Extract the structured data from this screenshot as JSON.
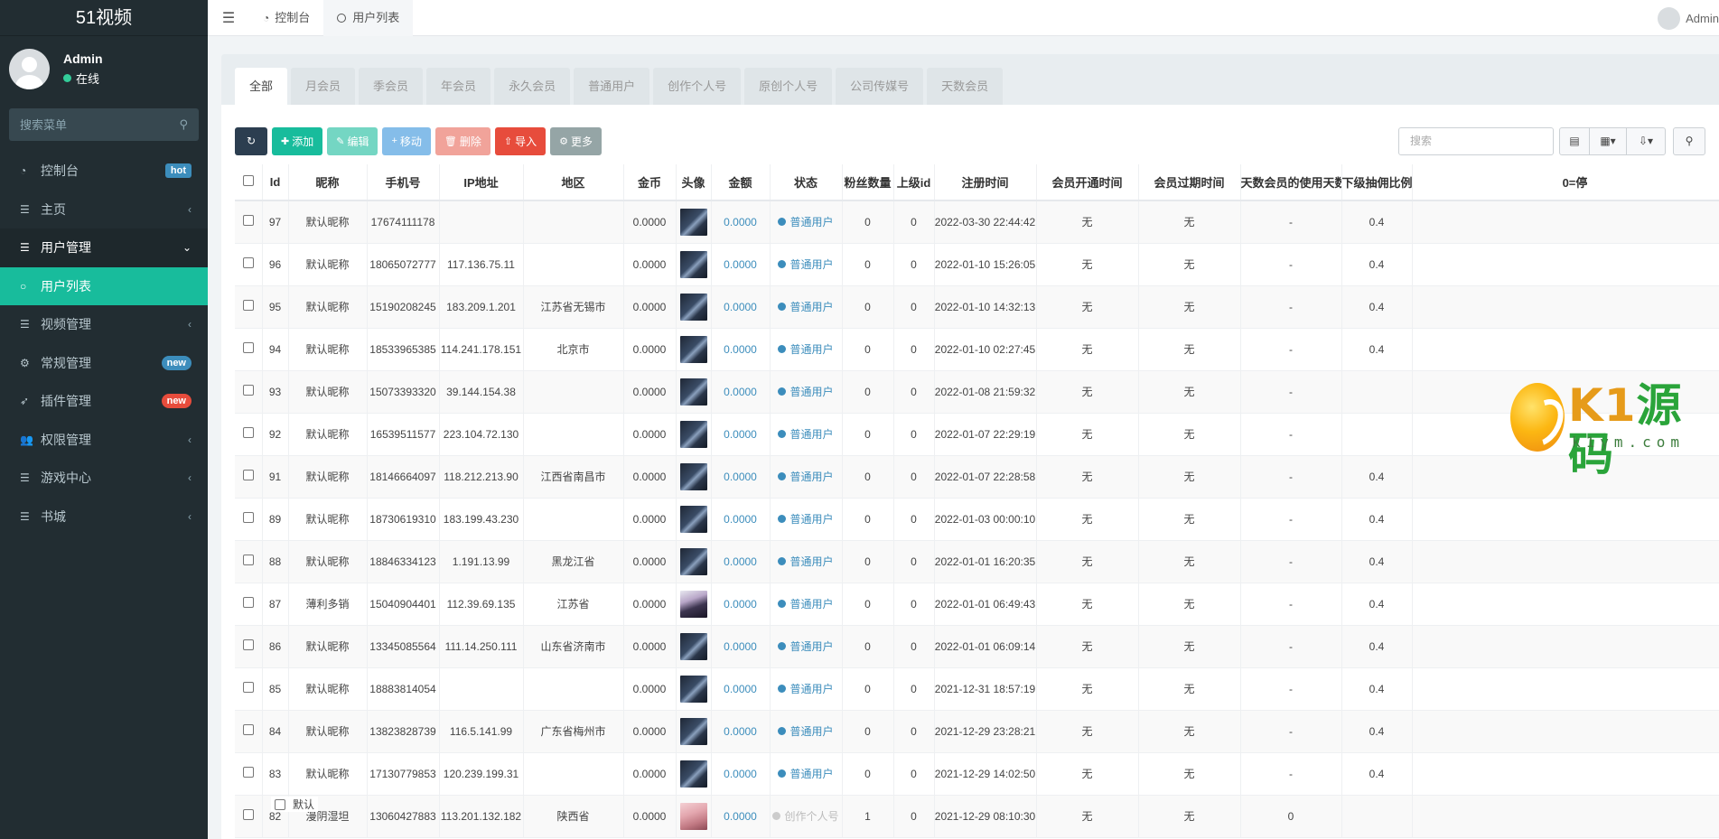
{
  "app": {
    "title": "51视频"
  },
  "sidebar": {
    "user": {
      "name": "Admin",
      "status": "在线"
    },
    "search_placeholder": "搜索菜单",
    "items": [
      {
        "icon": "dashboard-icon",
        "glyph": "◔",
        "label": "控制台",
        "badge": "hot",
        "badge_color": "#3c8dbc",
        "state": "normal",
        "arrow": ""
      },
      {
        "icon": "list-icon",
        "glyph": "☰",
        "label": "主页",
        "badge": "",
        "state": "normal",
        "arrow": "‹"
      },
      {
        "icon": "list-icon",
        "glyph": "☰",
        "label": "用户管理",
        "badge": "",
        "state": "open",
        "arrow": "⌄"
      },
      {
        "icon": "circle-icon",
        "glyph": "○",
        "label": "用户列表",
        "badge": "",
        "state": "active",
        "arrow": ""
      },
      {
        "icon": "list-icon",
        "glyph": "☰",
        "label": "视频管理",
        "badge": "",
        "state": "normal",
        "arrow": "‹"
      },
      {
        "icon": "cogs-icon",
        "glyph": "⚙",
        "label": "常规管理",
        "badge": "new",
        "badge_color": "#3c8dbc",
        "state": "normal",
        "arrow": ""
      },
      {
        "icon": "rocket-icon",
        "glyph": "➶",
        "label": "插件管理",
        "badge": "new",
        "badge_color": "#e74c3c",
        "state": "normal",
        "arrow": ""
      },
      {
        "icon": "users-icon",
        "glyph": "👥",
        "label": "权限管理",
        "badge": "",
        "state": "normal",
        "arrow": "‹"
      },
      {
        "icon": "list-icon",
        "glyph": "☰",
        "label": "游戏中心",
        "badge": "",
        "state": "normal",
        "arrow": "‹"
      },
      {
        "icon": "list-icon",
        "glyph": "☰",
        "label": "书城",
        "badge": "",
        "state": "normal",
        "arrow": "‹"
      }
    ]
  },
  "topbar": {
    "tabs": [
      {
        "label": "控制台",
        "icon": "dashboard-icon"
      },
      {
        "label": "用户列表",
        "icon": "circle-icon"
      }
    ],
    "user": "Admin"
  },
  "filter_tabs": [
    "全部",
    "月会员",
    "季会员",
    "年会员",
    "永久会员",
    "普通用户",
    "创作个人号",
    "原创个人号",
    "公司传媒号",
    "天数会员"
  ],
  "toolbar": {
    "add": "添加",
    "edit": "编辑",
    "move": "移动",
    "delete": "删除",
    "import": "导入",
    "more": "更多",
    "search_placeholder": "搜索"
  },
  "table": {
    "columns": [
      "",
      "Id",
      "昵称",
      "手机号",
      "IP地址",
      "地区",
      "金币",
      "头像",
      "金额",
      "状态",
      "粉丝数量",
      "上级id",
      "注册时间",
      "会员开通时间",
      "会员过期时间",
      "天数会员的使用天数",
      "下级抽佣比例",
      "0=停"
    ],
    "rows": [
      {
        "id": "97",
        "nick": "默认昵称",
        "phone": "17674111178",
        "ip": "",
        "region": "",
        "coin": "0.0000",
        "avatar": "dark",
        "amount": "0.0000",
        "status": "普通用户",
        "fans": "0",
        "parent": "0",
        "reg": "2022-03-30 22:44:42",
        "vip_start": "无",
        "vip_end": "无",
        "days": "-",
        "ratio": "0.4"
      },
      {
        "id": "96",
        "nick": "默认昵称",
        "phone": "18065072777",
        "ip": "117.136.75.11",
        "region": "",
        "coin": "0.0000",
        "avatar": "dark",
        "amount": "0.0000",
        "status": "普通用户",
        "fans": "0",
        "parent": "0",
        "reg": "2022-01-10 15:26:05",
        "vip_start": "无",
        "vip_end": "无",
        "days": "-",
        "ratio": "0.4"
      },
      {
        "id": "95",
        "nick": "默认昵称",
        "phone": "15190208245",
        "ip": "183.209.1.201",
        "region": "江苏省无锡市",
        "coin": "0.0000",
        "avatar": "dark",
        "amount": "0.0000",
        "status": "普通用户",
        "fans": "0",
        "parent": "0",
        "reg": "2022-01-10 14:32:13",
        "vip_start": "无",
        "vip_end": "无",
        "days": "-",
        "ratio": "0.4"
      },
      {
        "id": "94",
        "nick": "默认昵称",
        "phone": "18533965385",
        "ip": "114.241.178.151",
        "region": "北京市",
        "coin": "0.0000",
        "avatar": "dark",
        "amount": "0.0000",
        "status": "普通用户",
        "fans": "0",
        "parent": "0",
        "reg": "2022-01-10 02:27:45",
        "vip_start": "无",
        "vip_end": "无",
        "days": "-",
        "ratio": "0.4"
      },
      {
        "id": "93",
        "nick": "默认昵称",
        "phone": "15073393320",
        "ip": "39.144.154.38",
        "region": "",
        "coin": "0.0000",
        "avatar": "dark",
        "amount": "0.0000",
        "status": "普通用户",
        "fans": "0",
        "parent": "0",
        "reg": "2022-01-08 21:59:32",
        "vip_start": "无",
        "vip_end": "无",
        "days": "-",
        "ratio": ""
      },
      {
        "id": "92",
        "nick": "默认昵称",
        "phone": "16539511577",
        "ip": "223.104.72.130",
        "region": "",
        "coin": "0.0000",
        "avatar": "dark",
        "amount": "0.0000",
        "status": "普通用户",
        "fans": "0",
        "parent": "0",
        "reg": "2022-01-07 22:29:19",
        "vip_start": "无",
        "vip_end": "无",
        "days": "-",
        "ratio": ""
      },
      {
        "id": "91",
        "nick": "默认昵称",
        "phone": "18146664097",
        "ip": "118.212.213.90",
        "region": "江西省南昌市",
        "coin": "0.0000",
        "avatar": "dark",
        "amount": "0.0000",
        "status": "普通用户",
        "fans": "0",
        "parent": "0",
        "reg": "2022-01-07 22:28:58",
        "vip_start": "无",
        "vip_end": "无",
        "days": "-",
        "ratio": "0.4"
      },
      {
        "id": "89",
        "nick": "默认昵称",
        "phone": "18730619310",
        "ip": "183.199.43.230",
        "region": "",
        "coin": "0.0000",
        "avatar": "dark",
        "amount": "0.0000",
        "status": "普通用户",
        "fans": "0",
        "parent": "0",
        "reg": "2022-01-03 00:00:10",
        "vip_start": "无",
        "vip_end": "无",
        "days": "-",
        "ratio": "0.4"
      },
      {
        "id": "88",
        "nick": "默认昵称",
        "phone": "18846334123",
        "ip": "1.191.13.99",
        "region": "黑龙江省",
        "coin": "0.0000",
        "avatar": "dark",
        "amount": "0.0000",
        "status": "普通用户",
        "fans": "0",
        "parent": "0",
        "reg": "2022-01-01 16:20:35",
        "vip_start": "无",
        "vip_end": "无",
        "days": "-",
        "ratio": "0.4"
      },
      {
        "id": "87",
        "nick": "薄利多销",
        "phone": "15040904401",
        "ip": "112.39.69.135",
        "region": "江苏省",
        "coin": "0.0000",
        "avatar": "girl",
        "amount": "0.0000",
        "status": "普通用户",
        "fans": "0",
        "parent": "0",
        "reg": "2022-01-01 06:49:43",
        "vip_start": "无",
        "vip_end": "无",
        "days": "-",
        "ratio": "0.4"
      },
      {
        "id": "86",
        "nick": "默认昵称",
        "phone": "13345085564",
        "ip": "111.14.250.111",
        "region": "山东省济南市",
        "coin": "0.0000",
        "avatar": "dark",
        "amount": "0.0000",
        "status": "普通用户",
        "fans": "0",
        "parent": "0",
        "reg": "2022-01-01 06:09:14",
        "vip_start": "无",
        "vip_end": "无",
        "days": "-",
        "ratio": "0.4"
      },
      {
        "id": "85",
        "nick": "默认昵称",
        "phone": "18883814054",
        "ip": "",
        "region": "",
        "coin": "0.0000",
        "avatar": "dark",
        "amount": "0.0000",
        "status": "普通用户",
        "fans": "0",
        "parent": "0",
        "reg": "2021-12-31 18:57:19",
        "vip_start": "无",
        "vip_end": "无",
        "days": "-",
        "ratio": "0.4"
      },
      {
        "id": "84",
        "nick": "默认昵称",
        "phone": "13823828739",
        "ip": "116.5.141.99",
        "region": "广东省梅州市",
        "coin": "0.0000",
        "avatar": "dark",
        "amount": "0.0000",
        "status": "普通用户",
        "fans": "0",
        "parent": "0",
        "reg": "2021-12-29 23:28:21",
        "vip_start": "无",
        "vip_end": "无",
        "days": "-",
        "ratio": "0.4"
      },
      {
        "id": "83",
        "nick": "默认昵称",
        "phone": "17130779853",
        "ip": "120.239.199.31",
        "region": "",
        "coin": "0.0000",
        "avatar": "dark",
        "amount": "0.0000",
        "status": "普通用户",
        "fans": "0",
        "parent": "0",
        "reg": "2021-12-29 14:02:50",
        "vip_start": "无",
        "vip_end": "无",
        "days": "-",
        "ratio": "0.4"
      },
      {
        "id": "82",
        "nick": "漫阴湿坦",
        "phone": "13060427883",
        "ip": "113.201.132.182",
        "region": "陕西省",
        "coin": "0.0000",
        "avatar": "pink",
        "amount": "0.0000",
        "status": "创作个人号",
        "fans": "1",
        "parent": "0",
        "reg": "2021-12-29 08:10:30",
        "vip_start": "无",
        "vip_end": "无",
        "days": "0",
        "ratio": ""
      }
    ]
  },
  "overlay_text": "默认",
  "watermark": {
    "brand": "K1源码",
    "url": "k1ym.com"
  },
  "colors": {
    "sidebar_bg": "#222d32",
    "accent": "#18bc9c",
    "link": "#3c8dbc",
    "danger": "#e74c3c"
  }
}
